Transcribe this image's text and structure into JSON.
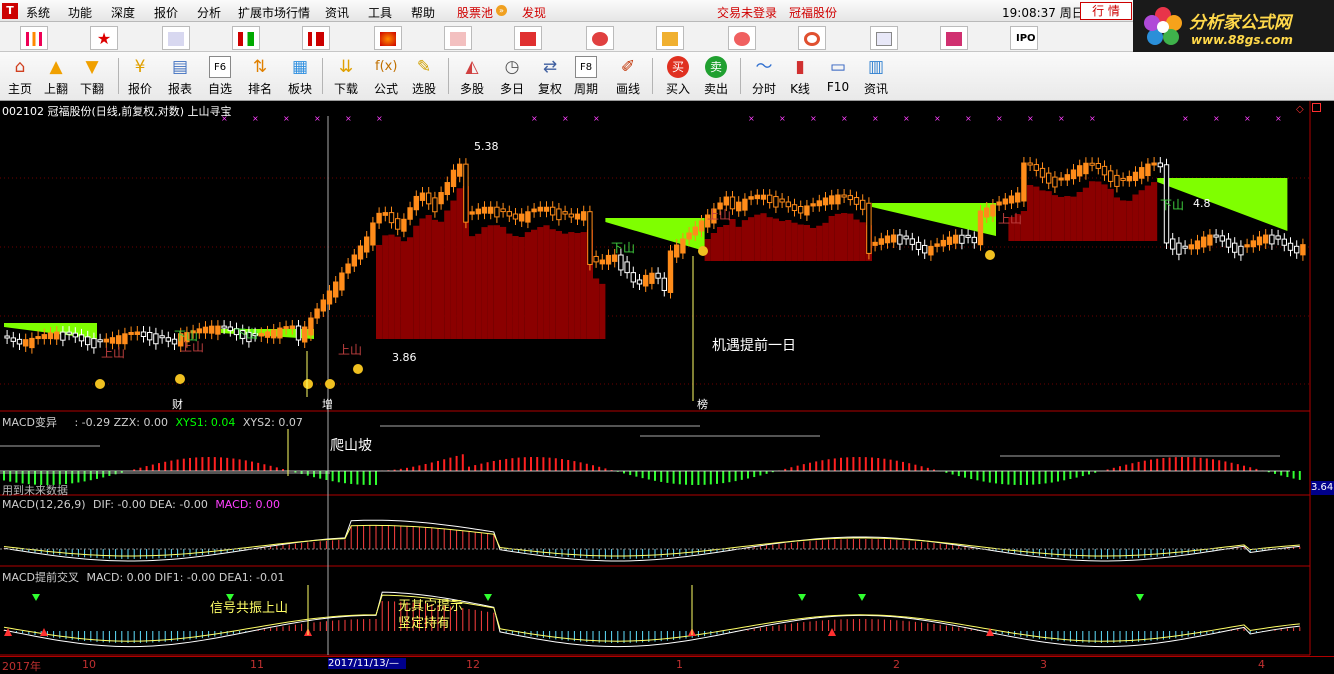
{
  "menubar": {
    "logo": "T",
    "items": [
      "系统",
      "功能",
      "深度",
      "报价",
      "分析",
      "扩展市场行情",
      "资讯",
      "工具",
      "帮助"
    ],
    "stock_pool": "股票池",
    "discover": "发现",
    "login_status": "交易未登录",
    "stock_name": "冠福股份",
    "time": "19:08:37",
    "weekday": "周日",
    "quote_tab": "行 情"
  },
  "brand": {
    "title": "分析家公式网",
    "url": "www.88gs.com"
  },
  "toolbar": [
    {
      "label": "主页",
      "icon": "home-icon"
    },
    {
      "label": "上翻",
      "icon": "arrow-up-icon"
    },
    {
      "label": "下翻",
      "icon": "arrow-down-icon"
    },
    {
      "label": "报价",
      "icon": "yuan-icon"
    },
    {
      "label": "报表",
      "icon": "report-icon"
    },
    {
      "label": "自选",
      "icon": "f6-icon"
    },
    {
      "label": "排名",
      "icon": "ranking-icon"
    },
    {
      "label": "板块",
      "icon": "sector-icon"
    },
    {
      "label": "下载",
      "icon": "download-icon"
    },
    {
      "label": "公式",
      "icon": "formula-icon"
    },
    {
      "label": "选股",
      "icon": "stock-picker-icon"
    },
    {
      "label": "多股",
      "icon": "multi-stock-icon"
    },
    {
      "label": "多日",
      "icon": "clock-icon"
    },
    {
      "label": "复权",
      "icon": "adjust-icon"
    },
    {
      "label": "周期",
      "icon": "f8-icon"
    },
    {
      "label": "画线",
      "icon": "pen-icon"
    },
    {
      "label": "买入",
      "icon": "buy-icon"
    },
    {
      "label": "卖出",
      "icon": "sell-icon"
    },
    {
      "label": "分时",
      "icon": "timeshare-icon"
    },
    {
      "label": "K线",
      "icon": "kline-icon"
    },
    {
      "label": "F10",
      "icon": "f10-icon"
    },
    {
      "label": "资讯",
      "icon": "news-icon"
    }
  ],
  "main_panel": {
    "title": "002102 冠福股份(日线,前复权,对数) 上山寻宝",
    "high_label": "5.38",
    "low_label": "3.86",
    "mid_label": "4.8",
    "price_tag": "3.64",
    "annotation": "机遇提前一日",
    "up_tags": [
      "上山",
      "上山",
      "上山",
      "上山",
      "上山"
    ],
    "down_tags": [
      "下山",
      "下山",
      "下山",
      "下山"
    ],
    "date_markers": [
      "财",
      "增",
      "榜"
    ]
  },
  "panel_macd_var": {
    "name": "MACD变异",
    "values_text": ": -0.29  ZZX: 0.00",
    "xys1_text": "XYS1: 0.04",
    "xys2_text": "XYS2: 0.07",
    "annotation": "爬山坡",
    "footer": "用到未来数据"
  },
  "panel_macd": {
    "name": "MACD(12,26,9)",
    "dif_text": "DIF: -0.00  DEA: -0.00",
    "macd_text": "MACD: 0.00"
  },
  "panel_macd_cross": {
    "name": "MACD提前交叉",
    "values_text": "MACD: 0.00  DIF1: -0.00  DEA1: -0.01",
    "annotation1": "信号共振上山",
    "annotation2_line1": "无其它提示",
    "annotation2_line2": "坚定持有"
  },
  "x_axis": {
    "labels": [
      "2017年",
      "10",
      "11",
      "2017/11/13/—",
      "12",
      "1",
      "2",
      "3",
      "4"
    ]
  },
  "colors": {
    "up": "#ff3030",
    "down": "#ffffff",
    "candle_orange": "#ff8c1a",
    "dark_red_fill": "#8b0000",
    "green_fill": "#7fff00",
    "yellow_line": "#ffff66",
    "magenta": "#ff40ff",
    "cyan_text": "#00ffff"
  }
}
